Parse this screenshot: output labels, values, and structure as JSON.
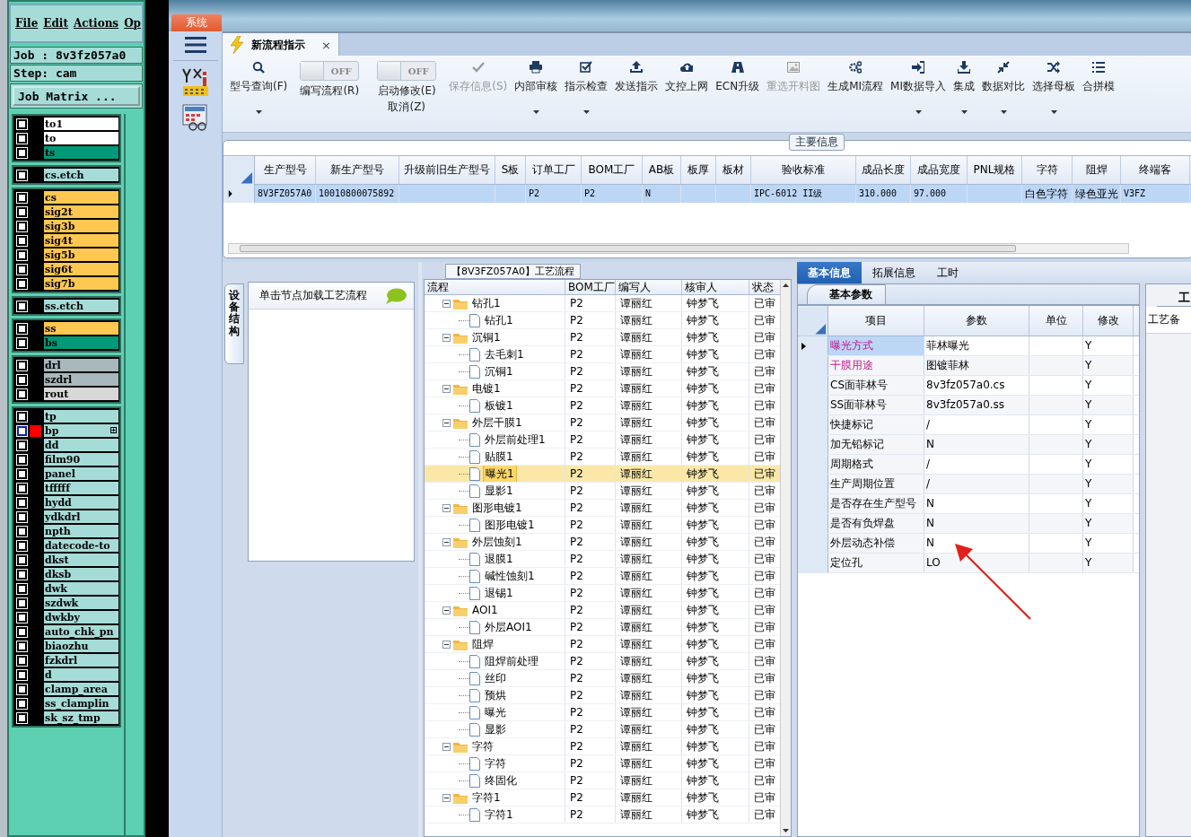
{
  "cam": {
    "menu": [
      "File",
      "Edit",
      "Actions",
      "Op"
    ],
    "job": "Job : 8v3fz057a0",
    "step": "Step: cam",
    "matrix_button": "Job Matrix ...",
    "layer_groups": [
      [
        {
          "name": "to1",
          "color": "#ffffff",
          "selected": false,
          "checked": false
        },
        {
          "name": "to",
          "color": "#ffffff",
          "selected": false,
          "checked": false
        },
        {
          "name": "ts",
          "color": "#009a78",
          "selected": false,
          "checked": false
        }
      ],
      [
        {
          "name": "cs.etch",
          "color": "#a6dcd8",
          "selected": false,
          "checked": false
        }
      ],
      [
        {
          "name": "cs",
          "color": "#ffc850",
          "selected": false,
          "checked": false
        },
        {
          "name": "sig2t",
          "color": "#ffc850",
          "selected": false,
          "checked": false
        },
        {
          "name": "sig3b",
          "color": "#ffc850",
          "selected": false,
          "checked": false
        },
        {
          "name": "sig4t",
          "color": "#ffc850",
          "selected": false,
          "checked": false
        },
        {
          "name": "sig5b",
          "color": "#ffc850",
          "selected": false,
          "checked": false
        },
        {
          "name": "sig6t",
          "color": "#ffc850",
          "selected": false,
          "checked": false
        },
        {
          "name": "sig7b",
          "color": "#ffc850",
          "selected": false,
          "checked": false
        }
      ],
      [
        {
          "name": "ss.etch",
          "color": "#a6dcd8",
          "selected": false,
          "checked": false
        }
      ],
      [
        {
          "name": "ss",
          "color": "#ffc850",
          "selected": false,
          "checked": false
        },
        {
          "name": "bs",
          "color": "#009a78",
          "selected": false,
          "checked": false
        }
      ],
      [
        {
          "name": "drl",
          "color": "#a8b8bc",
          "selected": false,
          "checked": false
        },
        {
          "name": "szdrl",
          "color": "#a8b8bc",
          "selected": false,
          "checked": false
        },
        {
          "name": "rout",
          "color": "#d8d8d8",
          "selected": false,
          "checked": false
        }
      ],
      [
        {
          "name": "tp",
          "color": "#a6dcd8",
          "selected": false,
          "checked": false
        },
        {
          "name": "bp",
          "color": "#a6dcd8",
          "selected": true,
          "checked": false
        },
        {
          "name": "dd",
          "color": "#a6dcd8",
          "selected": false,
          "checked": false
        },
        {
          "name": "film90",
          "color": "#a6dcd8",
          "selected": false,
          "checked": false
        },
        {
          "name": "panel",
          "color": "#a6dcd8",
          "selected": false,
          "checked": false
        },
        {
          "name": "tfffff",
          "color": "#a6dcd8",
          "selected": false,
          "checked": false
        },
        {
          "name": "hydd",
          "color": "#a6dcd8",
          "selected": false,
          "checked": false
        },
        {
          "name": "ydkdrl",
          "color": "#a6dcd8",
          "selected": false,
          "checked": false
        },
        {
          "name": "npth",
          "color": "#a6dcd8",
          "selected": false,
          "checked": false
        },
        {
          "name": "datecode-to",
          "color": "#a6dcd8",
          "selected": false,
          "checked": false
        },
        {
          "name": "dkst",
          "color": "#a6dcd8",
          "selected": false,
          "checked": false
        },
        {
          "name": "dksb",
          "color": "#a6dcd8",
          "selected": false,
          "checked": false
        },
        {
          "name": "dwk",
          "color": "#a6dcd8",
          "selected": false,
          "checked": false
        },
        {
          "name": "szdwk",
          "color": "#a6dcd8",
          "selected": false,
          "checked": false
        },
        {
          "name": "dwkby",
          "color": "#a6dcd8",
          "selected": false,
          "checked": false
        },
        {
          "name": "auto_chk_pn",
          "color": "#a6dcd8",
          "selected": false,
          "checked": false
        },
        {
          "name": "biaozhu",
          "color": "#a6dcd8",
          "selected": false,
          "checked": false
        },
        {
          "name": "fzkdrl",
          "color": "#a6dcd8",
          "selected": false,
          "checked": false
        },
        {
          "name": "d",
          "color": "#a6dcd8",
          "selected": false,
          "checked": false
        },
        {
          "name": "clamp_area",
          "color": "#a6dcd8",
          "selected": false,
          "checked": false
        },
        {
          "name": "ss_clamplin",
          "color": "#a6dcd8",
          "selected": false,
          "checked": false
        },
        {
          "name": "sk_sz_tmp",
          "color": "#a6dcd8",
          "selected": false,
          "checked": false
        }
      ]
    ]
  },
  "system_tab": "系统",
  "doc_tab": {
    "title": "新流程指示",
    "close": "×"
  },
  "toolbar": [
    {
      "kind": "button",
      "label": "型号查询(F)",
      "dropdown": true,
      "disabled": false
    },
    {
      "kind": "toggle",
      "state": "OFF",
      "on": false,
      "label": "编写流程(R)"
    },
    {
      "kind": "toggle",
      "state": "OFF",
      "on": false,
      "label": "启动修改(E)",
      "sublabel": "取消(Z)"
    },
    {
      "kind": "button",
      "label": "保存信息(S)",
      "dropdown": false,
      "disabled": true
    },
    {
      "kind": "button",
      "label": "内部审核",
      "dropdown": true,
      "disabled": false
    },
    {
      "kind": "button",
      "label": "指示检查",
      "dropdown": true,
      "disabled": false
    },
    {
      "kind": "button",
      "label": "发送指示",
      "dropdown": false,
      "disabled": false
    },
    {
      "kind": "button",
      "label": "文控上网",
      "dropdown": false,
      "disabled": false
    },
    {
      "kind": "button",
      "label": "ECN升级",
      "dropdown": false,
      "disabled": false
    },
    {
      "kind": "button",
      "label": "重选开料图",
      "dropdown": false,
      "disabled": true
    },
    {
      "kind": "button",
      "label": "生成MI流程",
      "dropdown": false,
      "disabled": false
    },
    {
      "kind": "button",
      "label": "MI数据导入",
      "dropdown": true,
      "disabled": false
    },
    {
      "kind": "button",
      "label": "集成",
      "dropdown": true,
      "disabled": false
    },
    {
      "kind": "button",
      "label": "数据对比",
      "dropdown": true,
      "disabled": false
    },
    {
      "kind": "button",
      "label": "选择母板",
      "dropdown": true,
      "disabled": false
    },
    {
      "kind": "button",
      "label": "合拼模",
      "dropdown": false,
      "disabled": false
    }
  ],
  "main_info": {
    "title": "主要信息",
    "columns": [
      "生产型号",
      "新生产型号",
      "升级前旧生产型号",
      "S板",
      "订单工厂",
      "BOM工厂",
      "AB板",
      "板厚",
      "板材",
      "验收标准",
      "成品长度",
      "成品宽度",
      "PNL规格",
      "字符",
      "阻焊",
      "终端客"
    ],
    "rows": [
      {
        "selected": true,
        "cells": [
          "8V3FZ057A0",
          "10010800075892",
          null,
          null,
          "P2",
          "P2",
          "N",
          null,
          null,
          "IPC-6012 II级",
          "310.000",
          "97.000",
          null,
          "白色字符",
          "绿色亚光",
          "V3FZ"
        ]
      }
    ]
  },
  "device_panel": {
    "tab": "设备结构",
    "hint": "单击节点加载工艺流程"
  },
  "flow": {
    "title": "【8V3FZ057A0】工艺流程",
    "columns": [
      "流程",
      "BOM工厂",
      "编写人",
      "核审人",
      "状态"
    ],
    "nodes": [
      {
        "label": "钻孔1",
        "bom": "P2",
        "writer": "谭丽红",
        "reviewer": "钟梦飞",
        "status": "已审",
        "expanded": true,
        "selected": false,
        "children": [
          {
            "label": "钻孔1",
            "bom": "P2",
            "writer": "谭丽红",
            "reviewer": "钟梦飞",
            "status": "已审",
            "selected": false
          }
        ]
      },
      {
        "label": "沉铜1",
        "bom": "P2",
        "writer": "谭丽红",
        "reviewer": "钟梦飞",
        "status": "已审",
        "expanded": true,
        "selected": false,
        "children": [
          {
            "label": "去毛刺1",
            "bom": "P2",
            "writer": "谭丽红",
            "reviewer": "钟梦飞",
            "status": "已审",
            "selected": false
          },
          {
            "label": "沉铜1",
            "bom": "P2",
            "writer": "谭丽红",
            "reviewer": "钟梦飞",
            "status": "已审",
            "selected": false
          }
        ]
      },
      {
        "label": "电镀1",
        "bom": "P2",
        "writer": "谭丽红",
        "reviewer": "钟梦飞",
        "status": "已审",
        "expanded": true,
        "selected": false,
        "children": [
          {
            "label": "板镀1",
            "bom": "P2",
            "writer": "谭丽红",
            "reviewer": "钟梦飞",
            "status": "已审",
            "selected": false
          }
        ]
      },
      {
        "label": "外层干膜1",
        "bom": "P2",
        "writer": "谭丽红",
        "reviewer": "钟梦飞",
        "status": "已审",
        "expanded": true,
        "selected": false,
        "children": [
          {
            "label": "外层前处理1",
            "bom": "P2",
            "writer": "谭丽红",
            "reviewer": "钟梦飞",
            "status": "已审",
            "selected": false
          },
          {
            "label": "贴膜1",
            "bom": "P2",
            "writer": "谭丽红",
            "reviewer": "钟梦飞",
            "status": "已审",
            "selected": false
          },
          {
            "label": "曝光1",
            "bom": "P2",
            "writer": "谭丽红",
            "reviewer": "钟梦飞",
            "status": "已审",
            "selected": true
          },
          {
            "label": "显影1",
            "bom": "P2",
            "writer": "谭丽红",
            "reviewer": "钟梦飞",
            "status": "已审",
            "selected": false
          }
        ]
      },
      {
        "label": "图形电镀1",
        "bom": "P2",
        "writer": "谭丽红",
        "reviewer": "钟梦飞",
        "status": "已审",
        "expanded": true,
        "selected": false,
        "children": [
          {
            "label": "图形电镀1",
            "bom": "P2",
            "writer": "谭丽红",
            "reviewer": "钟梦飞",
            "status": "已审",
            "selected": false
          }
        ]
      },
      {
        "label": "外层蚀刻1",
        "bom": "P2",
        "writer": "谭丽红",
        "reviewer": "钟梦飞",
        "status": "已审",
        "expanded": true,
        "selected": false,
        "children": [
          {
            "label": "退膜1",
            "bom": "P2",
            "writer": "谭丽红",
            "reviewer": "钟梦飞",
            "status": "已审",
            "selected": false
          },
          {
            "label": "碱性蚀刻1",
            "bom": "P2",
            "writer": "谭丽红",
            "reviewer": "钟梦飞",
            "status": "已审",
            "selected": false
          },
          {
            "label": "退锡1",
            "bom": "P2",
            "writer": "谭丽红",
            "reviewer": "钟梦飞",
            "status": "已审",
            "selected": false
          }
        ]
      },
      {
        "label": "AOI1",
        "bom": "P2",
        "writer": "谭丽红",
        "reviewer": "钟梦飞",
        "status": "已审",
        "expanded": true,
        "selected": false,
        "children": [
          {
            "label": "外层AOI1",
            "bom": "P2",
            "writer": "谭丽红",
            "reviewer": "钟梦飞",
            "status": "已审",
            "selected": false
          }
        ]
      },
      {
        "label": "阻焊",
        "bom": "P2",
        "writer": "谭丽红",
        "reviewer": "钟梦飞",
        "status": "已审",
        "expanded": true,
        "selected": false,
        "children": [
          {
            "label": "阻焊前处理",
            "bom": "P2",
            "writer": "谭丽红",
            "reviewer": "钟梦飞",
            "status": "已审",
            "selected": false
          },
          {
            "label": "丝印",
            "bom": "P2",
            "writer": "谭丽红",
            "reviewer": "钟梦飞",
            "status": "已审",
            "selected": false
          },
          {
            "label": "预烘",
            "bom": "P2",
            "writer": "谭丽红",
            "reviewer": "钟梦飞",
            "status": "已审",
            "selected": false
          },
          {
            "label": "曝光",
            "bom": "P2",
            "writer": "谭丽红",
            "reviewer": "钟梦飞",
            "status": "已审",
            "selected": false
          },
          {
            "label": "显影",
            "bom": "P2",
            "writer": "谭丽红",
            "reviewer": "钟梦飞",
            "status": "已审",
            "selected": false
          }
        ]
      },
      {
        "label": "字符",
        "bom": "P2",
        "writer": "谭丽红",
        "reviewer": "钟梦飞",
        "status": "已审",
        "expanded": true,
        "selected": false,
        "children": [
          {
            "label": "字符",
            "bom": "P2",
            "writer": "谭丽红",
            "reviewer": "钟梦飞",
            "status": "已审",
            "selected": false
          },
          {
            "label": "终固化",
            "bom": "P2",
            "writer": "谭丽红",
            "reviewer": "钟梦飞",
            "status": "已审",
            "selected": false
          }
        ]
      },
      {
        "label": "字符1",
        "bom": "P2",
        "writer": "谭丽红",
        "reviewer": "钟梦飞",
        "status": "已审",
        "expanded": true,
        "selected": false,
        "children": [
          {
            "label": "字符1",
            "bom": "P2",
            "writer": "谭丽红",
            "reviewer": "钟梦飞",
            "status": "已审",
            "selected": false
          }
        ]
      }
    ]
  },
  "detail": {
    "tabs": [
      {
        "label": "基本信息",
        "selected": true
      },
      {
        "label": "拓展信息",
        "selected": false
      },
      {
        "label": "工时",
        "selected": false
      }
    ],
    "subtab": "基本参数",
    "columns": [
      "项目",
      "参数",
      "单位",
      "修改"
    ],
    "rows": [
      {
        "item": "曝光方式",
        "param": "菲林曝光",
        "modify": "Y",
        "flagged": true,
        "selected": true
      },
      {
        "item": "干膜用途",
        "param": "图镀菲林",
        "modify": "Y",
        "flagged": true,
        "selected": false
      },
      {
        "item": "CS面菲林号",
        "param": "8v3fz057a0.cs",
        "modify": "Y",
        "flagged": false,
        "selected": false
      },
      {
        "item": "SS面菲林号",
        "param": "8v3fz057a0.ss",
        "modify": "Y",
        "flagged": false,
        "selected": false
      },
      {
        "item": "快捷标记",
        "param": "/",
        "modify": "Y",
        "flagged": false,
        "selected": false
      },
      {
        "item": "加无铅标记",
        "param": "N",
        "modify": "Y",
        "flagged": false,
        "selected": false
      },
      {
        "item": "周期格式",
        "param": "/",
        "modify": "Y",
        "flagged": false,
        "selected": false
      },
      {
        "item": "生产周期位置",
        "param": "/",
        "modify": "Y",
        "flagged": false,
        "selected": false
      },
      {
        "item": "是否存在生产型号",
        "param": "N",
        "modify": "Y",
        "flagged": false,
        "selected": false
      },
      {
        "item": "是否有负焊盘",
        "param": "N",
        "modify": "Y",
        "flagged": false,
        "selected": false
      },
      {
        "item": "外层动态补偿",
        "param": "N",
        "modify": "Y",
        "flagged": false,
        "selected": false
      },
      {
        "item": "定位孔",
        "param": "LO",
        "modify": "Y",
        "flagged": false,
        "selected": false
      }
    ]
  },
  "side_panel": {
    "tab": "工",
    "label": "工艺备"
  }
}
